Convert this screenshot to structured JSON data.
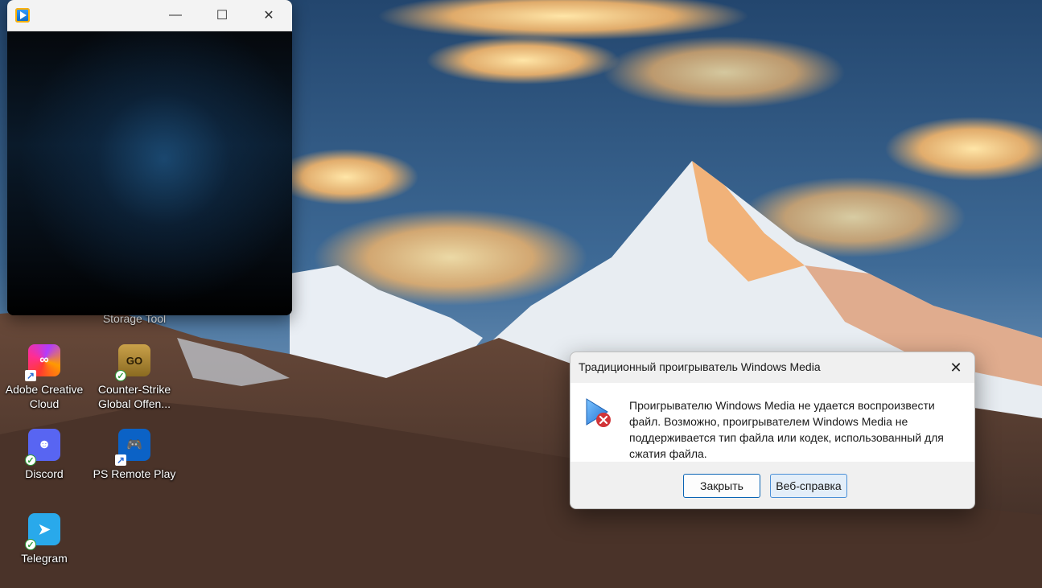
{
  "desktop": {
    "partial_label": "Storage Tool",
    "icons": [
      {
        "label": "Adobe Creative Cloud",
        "line1": "Adobe Creative",
        "line2": "Cloud",
        "icon": "adobe-creative-cloud-icon"
      },
      {
        "label": "Counter-Strike Global Offen...",
        "line1": "Counter-Strike",
        "line2": "Global Offen...",
        "icon": "counter-strike-icon",
        "glyph": "GO"
      },
      {
        "label": "Discord",
        "icon": "discord-icon"
      },
      {
        "label": "PS Remote Play",
        "icon": "ps-remote-play-icon"
      },
      {
        "label": "Telegram",
        "icon": "telegram-icon"
      }
    ]
  },
  "player_window": {
    "icon": "windows-media-player-icon",
    "controls": {
      "minimize": "—",
      "maximize": "☐",
      "close": "✕"
    }
  },
  "dialog": {
    "title": "Традиционный проигрыватель Windows Media",
    "close_glyph": "✕",
    "message": "Проигрывателю Windows Media не удается воспроизвести файл. Возможно, проигрывателем Windows Media не поддерживается тип файла или кодек, использованный для сжатия файла.",
    "buttons": {
      "close": "Закрыть",
      "help": "Веб-справка"
    },
    "icon": "media-error-icon"
  },
  "colors": {
    "accent": "#0a64b4",
    "error_badge": "#d13438"
  }
}
